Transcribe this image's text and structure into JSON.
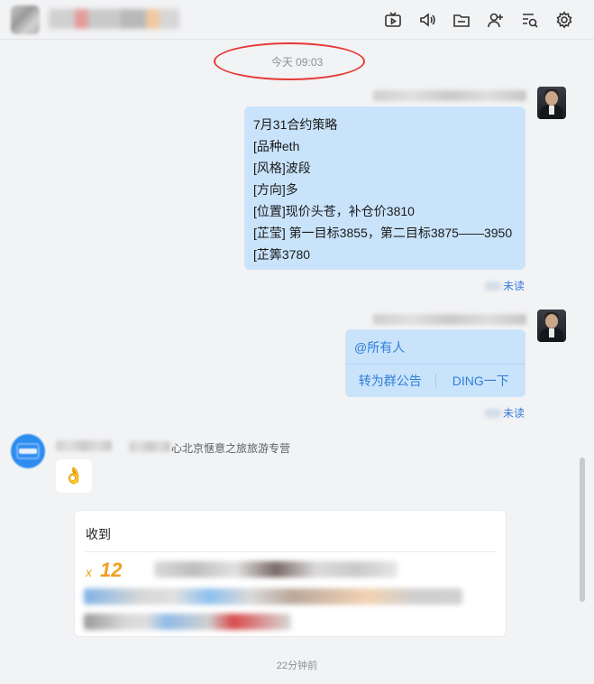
{
  "header": {
    "title": "▒▒▒▒▒▒",
    "tools": [
      {
        "icon": "tv-icon"
      },
      {
        "icon": "speaker-icon"
      },
      {
        "icon": "folder-icon"
      },
      {
        "icon": "add-user-icon"
      },
      {
        "icon": "search-list-icon"
      },
      {
        "icon": "settings-icon"
      }
    ]
  },
  "divider_time": "今天 09:03",
  "messages": {
    "strategy": {
      "lines": [
        "7月31合约策略",
        "[品种eth",
        "[风格]波段",
        "[方向]多",
        "[位置]现价头苍，补仓价3810",
        "[芷莹] 第一目标3855，第二目标3875——3950",
        "[芷筭3780"
      ],
      "status": "未读"
    },
    "mention": {
      "text": "@所有人",
      "action_announce": "转为群公告",
      "action_ding": "DING一下",
      "status": "未读"
    },
    "incoming": {
      "group_suffix": "心北京惬意之旅旅游专营",
      "emoji": "👌"
    },
    "card": {
      "title": "收到",
      "multiplier_prefix": "x",
      "multiplier": "12"
    }
  },
  "bottom_time": "22分钟前",
  "colors": {
    "bubble_out": "#c9e3fb",
    "link_blue": "#2f7ed8",
    "highlight_red": "#e53935",
    "multiplier_orange": "#f0a020"
  }
}
